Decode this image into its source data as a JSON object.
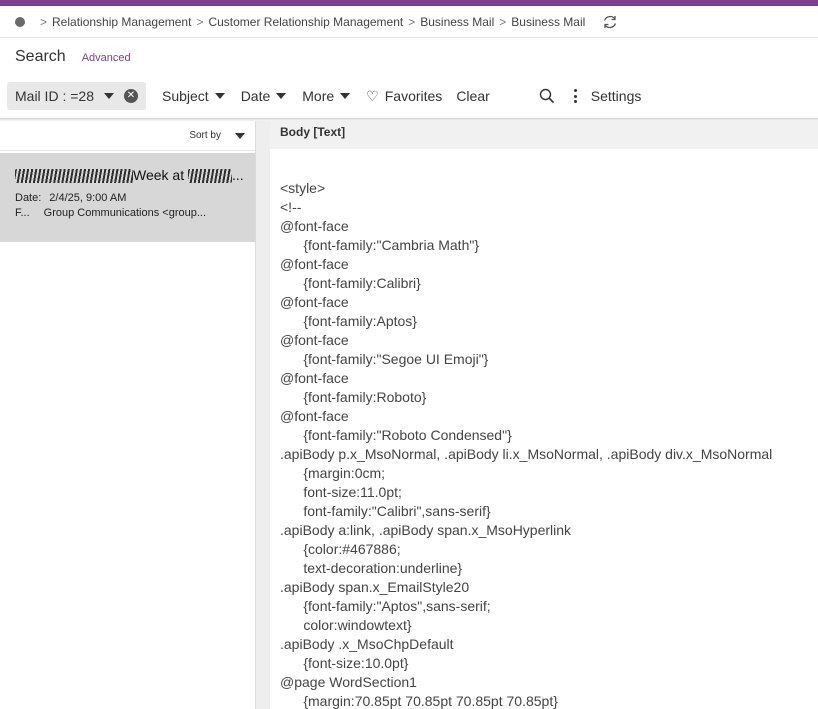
{
  "breadcrumb": {
    "items": [
      "Relationship Management",
      "Customer Relationship Management",
      "Business Mail",
      "Business Mail"
    ]
  },
  "search": {
    "title": "Search",
    "advanced": "Advanced"
  },
  "filters": {
    "chip_label": "Mail ID : =28",
    "subject": "Subject",
    "date": "Date",
    "more": "More",
    "favorites": "Favorites",
    "clear": "Clear",
    "settings": "Settings"
  },
  "list": {
    "sort_label": "Sort by",
    "items": [
      {
        "subject_visible": "Week at",
        "date_label": "Date:",
        "date_value": "2/4/25, 9:00 AM",
        "from_label": "F...",
        "from_value": "Group Communications <group..."
      }
    ]
  },
  "detail": {
    "header": "Body [Text]",
    "lines": [
      "<style>",
      "<!--",
      "@font-face",
      "\t{font-family:\"Cambria Math\"}",
      "@font-face",
      "\t{font-family:Calibri}",
      "@font-face",
      "\t{font-family:Aptos}",
      "@font-face",
      "\t{font-family:\"Segoe UI Emoji\"}",
      "@font-face",
      "\t{font-family:Roboto}",
      "@font-face",
      "\t{font-family:\"Roboto Condensed\"}",
      ".apiBody p.x_MsoNormal, .apiBody li.x_MsoNormal, .apiBody div.x_MsoNormal",
      "\t{margin:0cm;",
      "\tfont-size:11.0pt;",
      "\tfont-family:\"Calibri\",sans-serif}",
      ".apiBody a:link, .apiBody span.x_MsoHyperlink",
      "\t{color:#467886;",
      "\ttext-decoration:underline}",
      ".apiBody span.x_EmailStyle20",
      "\t{font-family:\"Aptos\",sans-serif;",
      "\tcolor:windowtext}",
      ".apiBody .x_MsoChpDefault",
      "\t{font-size:10.0pt}",
      "@page WordSection1",
      "\t{margin:70.85pt 70.85pt 70.85pt 70.85pt}"
    ]
  },
  "colors": {
    "accent": "#7d3f8c",
    "selected_row": "#d7d7d7"
  }
}
